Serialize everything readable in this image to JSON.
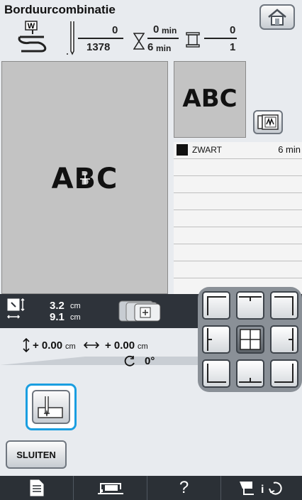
{
  "header": {
    "title": "Borduurcombinatie",
    "stitch_count_done": "0",
    "stitch_count_total": "1378",
    "time_done": "0",
    "time_total": "6",
    "time_unit": "min",
    "color_done": "0",
    "color_total": "1"
  },
  "preview": {
    "design_text": "ABC",
    "thumbnail_text": "ABC"
  },
  "thread_list": {
    "items": [
      {
        "color_name": "ZWART",
        "time": "6 min",
        "swatch": "#111111"
      }
    ]
  },
  "size": {
    "height_value": "3.2",
    "width_value": "9.1",
    "unit": "cm"
  },
  "offset": {
    "vertical_value": "+ 0.00",
    "horizontal_value": "+ 0.00",
    "unit": "cm",
    "rotation_value": "0°"
  },
  "buttons": {
    "close_label": "SLUITEN",
    "help_label": "?"
  },
  "colors": {
    "accent": "#1a9ee0",
    "dark_band": "#2e333a"
  }
}
